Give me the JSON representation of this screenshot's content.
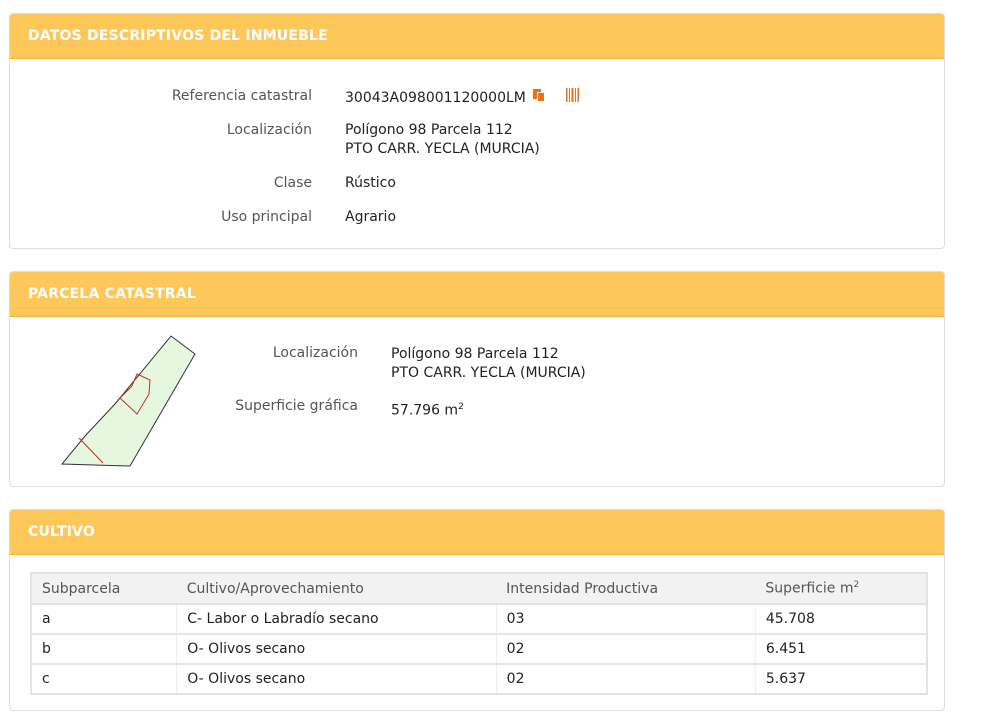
{
  "datos": {
    "title": "DATOS DESCRIPTIVOS DEL INMUEBLE",
    "referencia_label": "Referencia catastral",
    "referencia_value": "30043A098001120000LM",
    "localizacion_label": "Localización",
    "localizacion_line1": "Polígono 98 Parcela 112",
    "localizacion_line2": "PTO CARR. YECLA (MURCIA)",
    "clase_label": "Clase",
    "clase_value": "Rústico",
    "uso_label": "Uso principal",
    "uso_value": "Agrario",
    "icons": [
      "copy-icon",
      "barcode-icon"
    ]
  },
  "parcela": {
    "title": "PARCELA CATASTRAL",
    "localizacion_label": "Localización",
    "localizacion_line1": "Polígono 98 Parcela 112",
    "localizacion_line2": "PTO CARR. YECLA (MURCIA)",
    "superficie_label": "Superficie gráfica",
    "superficie_value": "57.796 m",
    "superficie_unit_sup": "2"
  },
  "cultivo": {
    "title": "CULTIVO",
    "headers": [
      "Subparcela",
      "Cultivo/Aprovechamiento",
      "Intensidad Productiva",
      "Superficie m"
    ],
    "header_sup": "2",
    "rows": [
      [
        "a",
        "C- Labor o Labradío secano",
        "03",
        "45.708"
      ],
      [
        "b",
        "O- Olivos secano",
        "02",
        "6.451"
      ],
      [
        "c",
        "O- Olivos secano",
        "02",
        "5.637"
      ]
    ]
  },
  "colors": {
    "header_bg": "#fdc75a",
    "icon_accent": "#e8731a",
    "parcel_fill": "#e6f7e0",
    "parcel_sub_line": "#cc2b1d"
  }
}
